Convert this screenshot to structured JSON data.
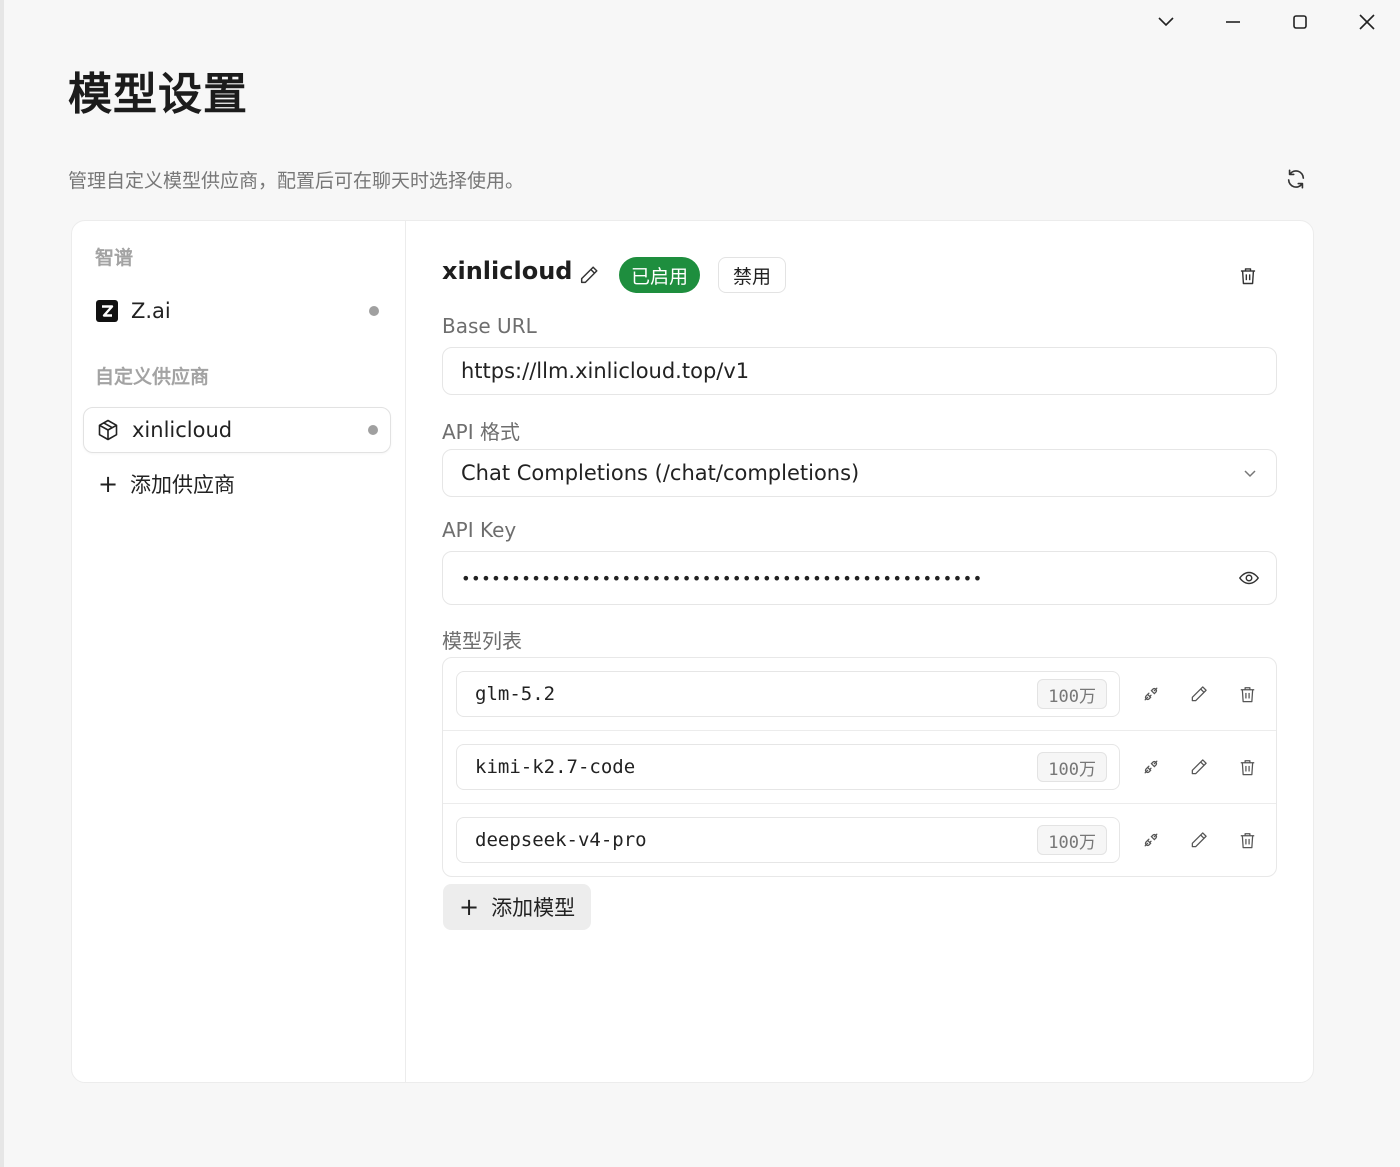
{
  "window": {
    "controls": [
      "chevron-down-icon",
      "minimize-icon",
      "maximize-icon",
      "close-icon"
    ]
  },
  "page": {
    "title": "模型设置",
    "subtitle": "管理自定义模型供应商，配置后可在聊天时选择使用。"
  },
  "sidebar": {
    "groups": [
      {
        "label": "智谱",
        "providers": [
          {
            "name": "Z.ai",
            "icon": "zai-logo-icon",
            "status": "dot"
          }
        ]
      },
      {
        "label": "自定义供应商",
        "providers": [
          {
            "name": "xinlicloud",
            "icon": "package-icon",
            "status": "dot",
            "selected": true
          }
        ]
      }
    ],
    "add_provider_label": "添加供应商"
  },
  "provider": {
    "name": "xinlicloud",
    "enabled_label": "已启用",
    "disable_label": "禁用",
    "enabled_color": "#1e8e3e",
    "base_url_label": "Base URL",
    "base_url_value": "https://llm.xinlicloud.top/v1",
    "api_format_label": "API 格式",
    "api_format_value": "Chat Completions (/chat/completions)",
    "api_key_label": "API Key",
    "api_key_masked": "••••••••••••••••••••••••••••••••••••••••••••••••••••",
    "models_label": "模型列表",
    "models": [
      {
        "name": "glm-5.2",
        "context": "100万"
      },
      {
        "name": "kimi-k2.7-code",
        "context": "100万"
      },
      {
        "name": "deepseek-v4-pro",
        "context": "100万"
      }
    ],
    "add_model_label": "添加模型"
  }
}
